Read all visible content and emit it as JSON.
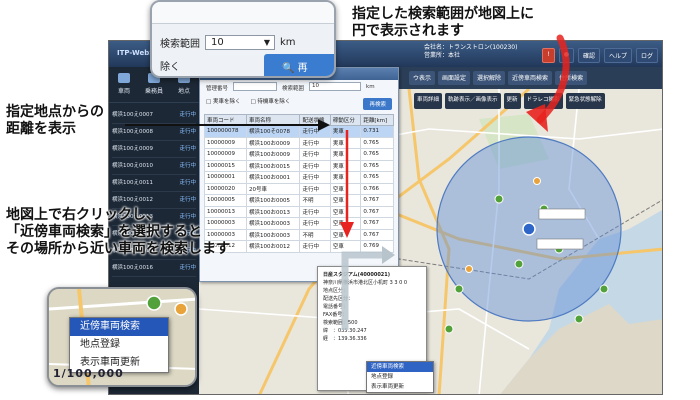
{
  "annotations": {
    "top_right": [
      "指定した検索範囲が地図上に",
      "円で表示されます"
    ],
    "left_distance": [
      "指定地点からの",
      "距離を表示"
    ],
    "left_search": [
      "地図上で右クリックし、",
      "「近傍車両検索」を選択すると",
      "その場所から近い車両を検索します"
    ]
  },
  "range_inset": {
    "label": "検索範囲",
    "value": "10",
    "unit": "km",
    "below_text": "除く",
    "button_label": "再"
  },
  "app": {
    "brand": "ITP-WebSer",
    "company_line1": "会社名：トランストロン(100230)",
    "company_line2": "営業所：本社",
    "nav": [
      "個",
      "",
      "確認",
      "ヘルプ",
      "ログ"
    ]
  },
  "sidebar": {
    "tabs": [
      "車両",
      "乗務員",
      "地点"
    ],
    "vehicles": [
      {
        "name": "横浜100え0007",
        "status": "走行中"
      },
      {
        "name": "横浜100え0008",
        "status": "走行中"
      },
      {
        "name": "横浜100え0009",
        "status": "走行中"
      },
      {
        "name": "横浜100え0010",
        "status": "走行中"
      },
      {
        "name": "横浜100え0011",
        "status": "走行中"
      },
      {
        "name": "横浜100え0012",
        "status": "走行中"
      },
      {
        "name": "横浜100え0013",
        "status": "走行中"
      },
      {
        "name": "横浜100え0014",
        "status": "走行中"
      },
      {
        "name": "横浜100え0015",
        "status": "走行中"
      },
      {
        "name": "横浜100え0016",
        "status": "走行中"
      }
    ]
  },
  "toolbar": {
    "items": [
      "ウ表示",
      "画面設定",
      "選択解除",
      "近傍車両検索",
      "住所検索"
    ],
    "items2": [
      "車両詳細",
      "軌跡表示／画像表示",
      "更新",
      "ドラレコ撮影",
      "緊急状態解除"
    ]
  },
  "panel": {
    "form": {
      "label_manage": "管理番号",
      "label_range": "検索範囲",
      "range_value": "10",
      "range_unit": "km",
      "check1": "実車を除く",
      "check2": "待機車を除く",
      "redo_button": "再検索"
    },
    "columns": [
      "車両コード",
      "車両名称",
      "配送状態",
      "稼動区分",
      "距離[km]"
    ],
    "rows": [
      [
        "100000078",
        "横浜100そ0078",
        "走行中",
        "実車",
        "0.731"
      ],
      [
        "10000009",
        "横浜100お0009",
        "走行中",
        "実車",
        "0.765"
      ],
      [
        "10000009",
        "横浜100お0009",
        "走行中",
        "実車",
        "0.765"
      ],
      [
        "10000015",
        "横浜100お0015",
        "走行中",
        "実車",
        "0.765"
      ],
      [
        "10000001",
        "横浜100お0001",
        "走行中",
        "実車",
        "0.765"
      ],
      [
        "10000020",
        "20号車",
        "走行中",
        "空車",
        "0.766"
      ],
      [
        "10000005",
        "横浜100お0005",
        "不明",
        "空車",
        "0.767"
      ],
      [
        "10000013",
        "横浜100お0013",
        "走行中",
        "空車",
        "0.767"
      ],
      [
        "10000003",
        "横浜100お0003",
        "走行中",
        "空車",
        "0.767"
      ],
      [
        "10000003",
        "横浜100お0003",
        "不明",
        "空車",
        "0.767"
      ],
      [
        "10000012",
        "横浜100お0012",
        "走行中",
        "空車",
        "0.769"
      ]
    ]
  },
  "place_popup": {
    "name": "日産スタジアム(40000021)",
    "lines": [
      "神奈川県横浜市港北区小机町 3 3 0 0",
      "地点区分：",
      "配送先区分：",
      "電話番号：",
      "FAX番号：",
      "検索範囲：500",
      "緯　：035.30.247",
      "経　：139.36.336"
    ]
  },
  "mini_menu": [
    "近傍車両検索",
    "地点登録",
    "表示車両更新"
  ],
  "ctx_inset": {
    "menu": [
      "近傍車両検索",
      "地点登録",
      "表示車両更新"
    ],
    "scale_text": "1/100,000"
  },
  "colors": {
    "search_circle": "#5f8fd6",
    "arrow_red": "#e8231f",
    "arrow_black": "#111111",
    "arrow_gray": "#b7c4cc"
  }
}
